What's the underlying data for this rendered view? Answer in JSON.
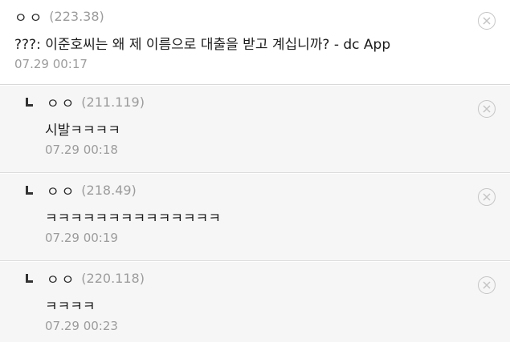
{
  "colors": {
    "root_background": "#ffffff",
    "reply_background": "#f6f6f6",
    "divider": "#d9d9d9",
    "meta_text": "#9c9c9c",
    "close_icon": "#c4c4c4"
  },
  "comments": [
    {
      "nickname": "ㅇㅇ",
      "ip": "(223.38)",
      "text": "???: 이준호씨는 왜 제 이름으로 대출을 받고 계십니까? - dc App",
      "date": "07.29 00:17",
      "icon": "close-circle-icon"
    }
  ],
  "replies": [
    {
      "marker_icon": "reply-arrow-icon",
      "nickname": "ㅇㅇ",
      "ip": "(211.119)",
      "text": "시발ㅋㅋㅋㅋ",
      "date": "07.29 00:18",
      "icon": "close-circle-icon"
    },
    {
      "marker_icon": "reply-arrow-icon",
      "nickname": "ㅇㅇ",
      "ip": "(218.49)",
      "text": "ㅋㅋㅋㅋㅋㅋㅋㅋㅋㅋㅋㅋㅋㅋ",
      "date": "07.29 00:19",
      "icon": "close-circle-icon"
    },
    {
      "marker_icon": "reply-arrow-icon",
      "nickname": "ㅇㅇ",
      "ip": "(220.118)",
      "text": "ㅋㅋㅋㅋ",
      "date": "07.29 00:23",
      "icon": "close-circle-icon"
    }
  ]
}
